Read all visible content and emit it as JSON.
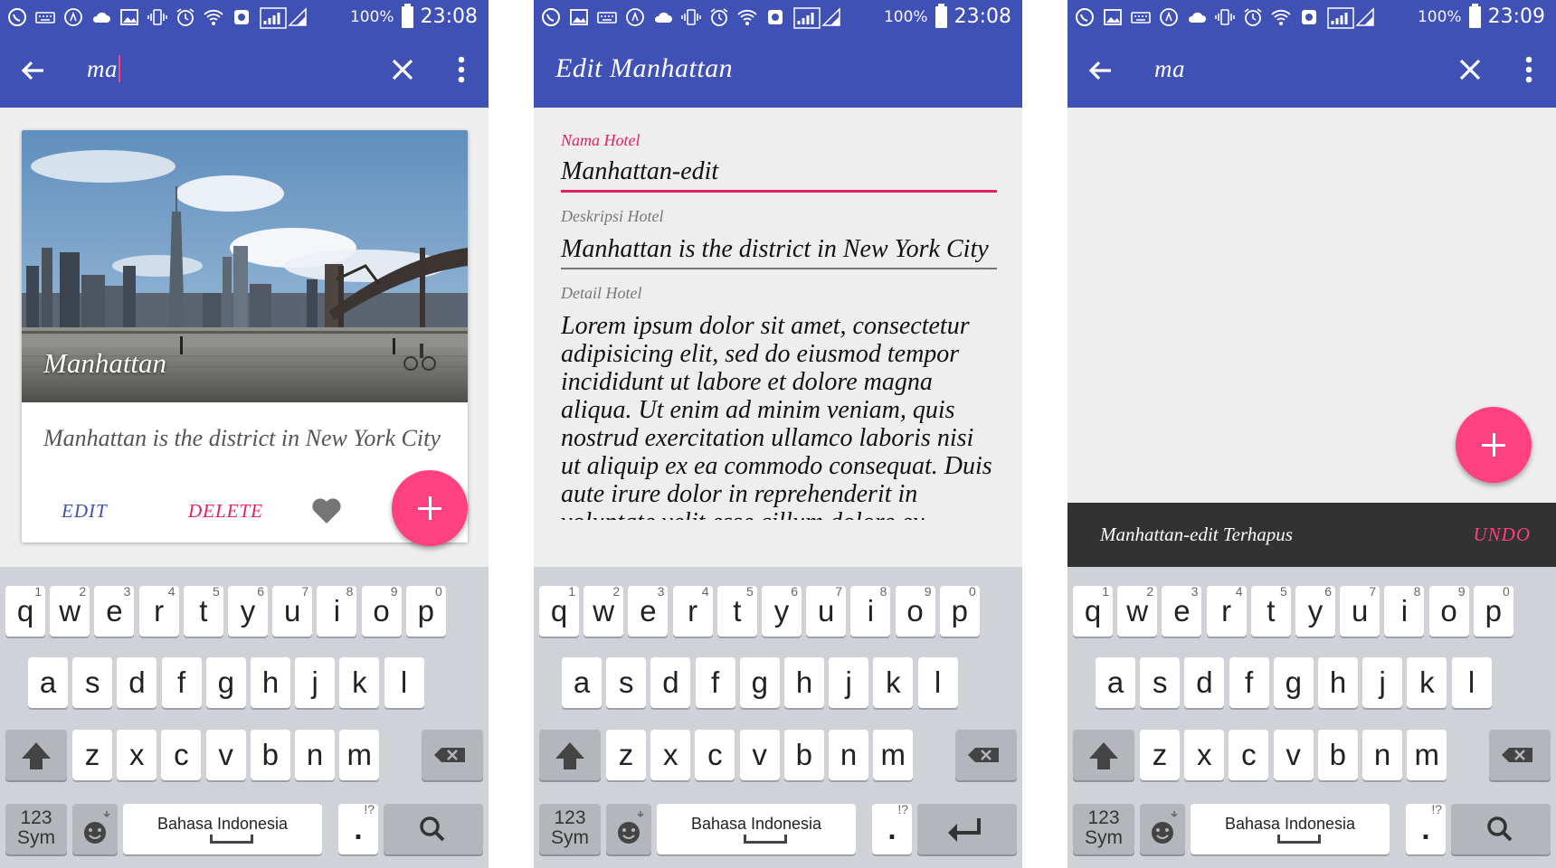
{
  "status_bar": {
    "battery_percent": "100%",
    "times": [
      "23:08",
      "23:08",
      "23:09"
    ]
  },
  "screen1": {
    "search_query": "ma",
    "card": {
      "title": "Manhattan",
      "description": "Manhattan is the district in New York City",
      "edit_label": "EDIT",
      "delete_label": "DELETE"
    }
  },
  "screen2": {
    "title": "Edit Manhattan",
    "fields": [
      {
        "label": "Nama Hotel",
        "value": "Manhattan-edit"
      },
      {
        "label": "Deskripsi Hotel",
        "value": "Manhattan is the district in New York City"
      },
      {
        "label": "Detail Hotel",
        "value": "Lorem ipsum dolor sit amet, consectetur adipisicing elit, sed do eiusmod tempor incididunt ut labore et dolore magna aliqua. Ut enim ad minim veniam, quis nostrud exercitation ullamco laboris nisi ut aliquip ex ea commodo consequat. Duis aute irure dolor in reprehenderit in voluptate velit esse cillum dolore eu"
      }
    ]
  },
  "screen3": {
    "search_query": "ma",
    "snackbar": {
      "message": "Manhattan-edit Terhapus",
      "action": "UNDO"
    }
  },
  "keyboard": {
    "row1": [
      {
        "k": "q",
        "h": "1"
      },
      {
        "k": "w",
        "h": "2"
      },
      {
        "k": "e",
        "h": "3"
      },
      {
        "k": "r",
        "h": "4"
      },
      {
        "k": "t",
        "h": "5"
      },
      {
        "k": "y",
        "h": "6"
      },
      {
        "k": "u",
        "h": "7"
      },
      {
        "k": "i",
        "h": "8"
      },
      {
        "k": "o",
        "h": "9"
      },
      {
        "k": "p",
        "h": "0"
      }
    ],
    "row2": [
      "a",
      "s",
      "d",
      "f",
      "g",
      "h",
      "j",
      "k",
      "l"
    ],
    "row3": [
      "z",
      "x",
      "c",
      "v",
      "b",
      "n",
      "m"
    ],
    "symbols_label_1": "123",
    "symbols_label_2": "Sym",
    "space_label": "Bahasa Indonesia",
    "period": ".",
    "period_hint": "!?"
  },
  "colors": {
    "primary": "#3f51b5",
    "accent": "#ff4081",
    "delete": "#e91e63",
    "snackbar": "#323232"
  }
}
